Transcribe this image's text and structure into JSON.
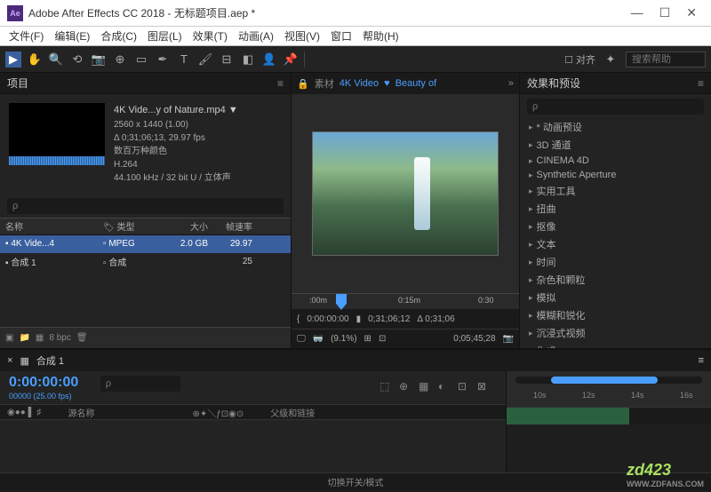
{
  "window": {
    "title": "Adobe After Effects CC 2018 - 无标题项目.aep *"
  },
  "menu": [
    "文件(F)",
    "编辑(E)",
    "合成(C)",
    "图层(L)",
    "效果(T)",
    "动画(A)",
    "视图(V)",
    "窗口",
    "帮助(H)"
  ],
  "toolbar": {
    "snap": "对齐",
    "search_placeholder": "搜索帮助"
  },
  "project": {
    "tab": "项目",
    "file": {
      "name": "4K Vide...y of Nature.mp4",
      "dims": "2560 x 1440 (1.00)",
      "dur": "Δ 0;31;06;13, 29.97 fps",
      "colors": "数百万种颜色",
      "codec": "H.264",
      "audio": "44.100 kHz / 32 bit U / 立体声"
    },
    "search_placeholder": "ρ",
    "cols": {
      "name": "名称",
      "type": "类型",
      "size": "大小",
      "fps": "帧速率"
    },
    "rows": [
      {
        "name": "4K Vide...4",
        "type": "MPEG",
        "size": "2.0 GB",
        "fps": "29.97"
      },
      {
        "name": "合成 1",
        "type": "合成",
        "size": "",
        "fps": "25"
      }
    ],
    "footer_bpc": "8 bpc"
  },
  "viewer": {
    "tab_source": "素材",
    "tab_file": "4K Video",
    "tab_beauty": "Beauty of",
    "ruler": {
      "t0": ":00m",
      "t1": "0:15m",
      "t2": "0:30"
    },
    "tc_left": "0:00:00:00",
    "tc_mid": "0;31;06;12",
    "tc_right": "Δ 0;31;06",
    "zoom": "(9.1%)",
    "footer_time": "0;05;45;28"
  },
  "effects": {
    "tab": "效果和预设",
    "search_placeholder": "ρ",
    "items": [
      "* 动画预设",
      "3D 通道",
      "CINEMA 4D",
      "Synthetic Aperture",
      "实用工具",
      "扭曲",
      "抠像",
      "文本",
      "时间",
      "杂色和颗粒",
      "模拟",
      "模糊和锐化",
      "沉浸式视频",
      "生成"
    ]
  },
  "timeline": {
    "tab": "合成 1",
    "timecode": "0:00:00:00",
    "fps": "00000 (25.00 fps)",
    "col_source": "源名称",
    "col_parent": "父级和链接",
    "ruler": [
      "10s",
      "12s",
      "14s",
      "16s"
    ],
    "footer": "切换开关/模式"
  },
  "watermark": {
    "logo": "zd423",
    "url": "WWW.ZDFANS.COM"
  }
}
